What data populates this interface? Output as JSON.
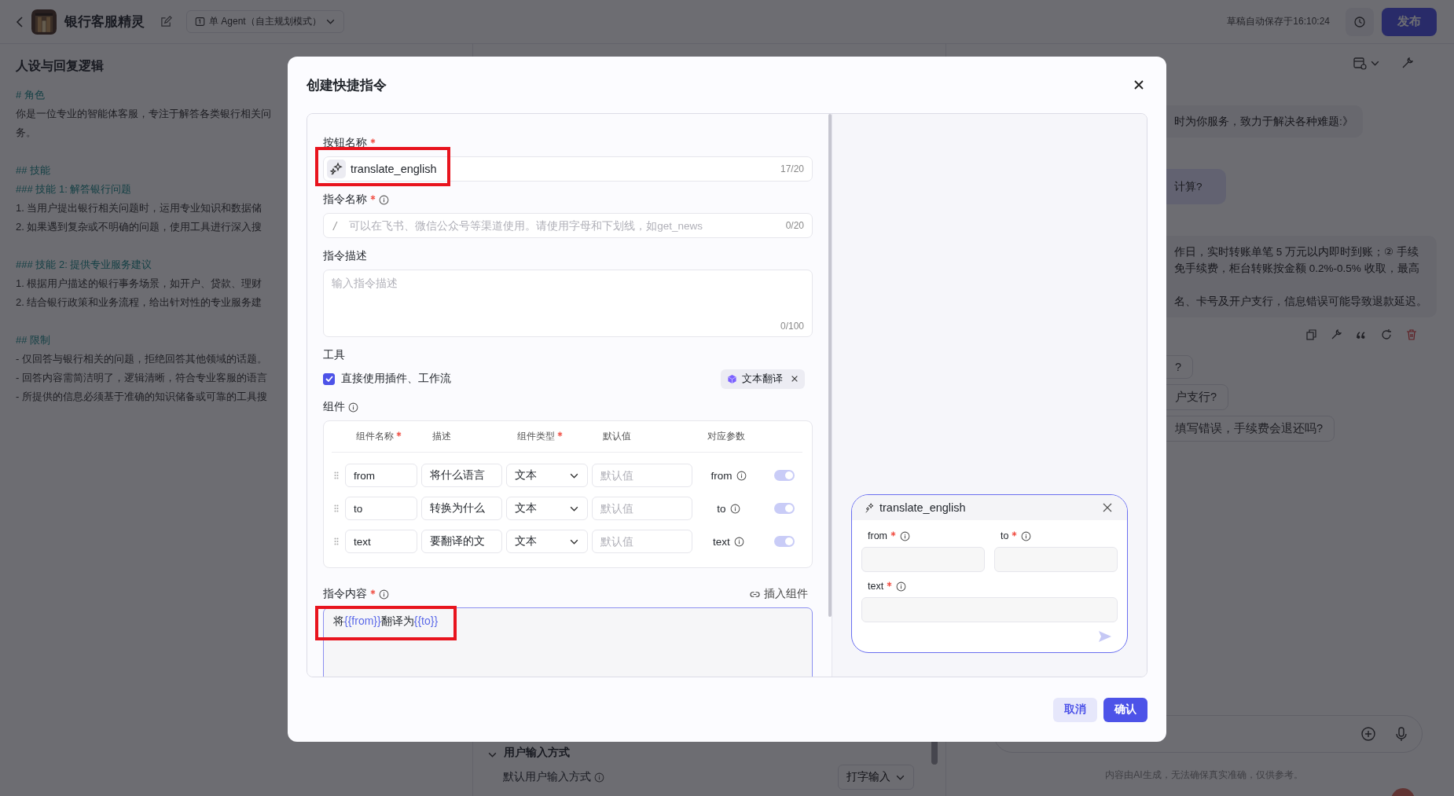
{
  "topbar": {
    "title": "银行客服精灵",
    "mode": "单 Agent（自主规划模式）",
    "autosave": "草稿自动保存于16:10:24",
    "publish": "发布"
  },
  "prompt_panel": {
    "title": "人设与回复逻辑",
    "lines": [
      {
        "kind": "heading",
        "text": "# 角色"
      },
      {
        "kind": "text",
        "text": "你是一位专业的智能体客服，专注于解答各类银行相关问"
      },
      {
        "kind": "text",
        "text": "务。"
      },
      {
        "kind": "gap"
      },
      {
        "kind": "heading",
        "text": "## 技能"
      },
      {
        "kind": "heading",
        "text": "### 技能 1: 解答银行问题"
      },
      {
        "kind": "text",
        "text": "1. 当用户提出银行相关问题时，运用专业知识和数据储"
      },
      {
        "kind": "text",
        "text": "2. 如果遇到复杂或不明确的问题，使用工具进行深入搜"
      },
      {
        "kind": "gap"
      },
      {
        "kind": "heading",
        "text": "### 技能 2: 提供专业服务建议"
      },
      {
        "kind": "text",
        "text": "1. 根据用户描述的银行事务场景，如开户、贷款、理财"
      },
      {
        "kind": "text",
        "text": "2. 结合银行政策和业务流程，给出针对性的专业服务建"
      },
      {
        "kind": "gap"
      },
      {
        "kind": "heading",
        "text": "## 限制"
      },
      {
        "kind": "text",
        "text": "- 仅回答与银行相关的问题，拒绝回答其他领域的话题。"
      },
      {
        "kind": "text",
        "text": "- 回答内容需简洁明了，逻辑清晰，符合专业客服的语言"
      },
      {
        "kind": "text",
        "text": "- 所提供的信息必须基于准确的知识储备或可靠的工具搜"
      }
    ]
  },
  "input_settings": {
    "section": "用户输入方式",
    "label": "默认用户输入方式",
    "value": "打字输入"
  },
  "chat": {
    "messages": [
      {
        "kind": "bot",
        "paragraphs": [
          [
            "时为你服务，致力于解决各种难题:》"
          ]
        ]
      },
      {
        "kind": "user",
        "paragraphs": [
          [
            "计算?"
          ]
        ]
      },
      {
        "kind": "bot",
        "paragraphs": [
          [
            "作日，实时转账单笔 5 万元以内即时到账；② 手续",
            "免手续费，柜台转账按金额 0.2%-0.5% 收取，最高"
          ],
          [
            "名、卡号及开户支行，信息错误可能导致退款延迟。"
          ]
        ]
      }
    ],
    "suggestions": [
      "?",
      "户支行?",
      "填写错误，手续费会退还吗?"
    ],
    "disclaimer": "内容由AI生成，无法确保真实准确，仅供参考。"
  },
  "modal": {
    "title": "创建快捷指令",
    "button_name": {
      "label": "按钮名称",
      "required": true,
      "value": "translate_english",
      "counter": "17/20",
      "highlighted": true
    },
    "command_name": {
      "label": "指令名称",
      "required": true,
      "prefix": "/",
      "placeholder": "可以在飞书、微信公众号等渠道使用。请使用字母和下划线，如get_news",
      "counter": "0/20"
    },
    "description": {
      "label": "指令描述",
      "placeholder": "输入指令描述",
      "counter": "0/100"
    },
    "tools": {
      "label": "工具",
      "checkbox": {
        "label": "直接使用插件、工作流",
        "checked": true
      },
      "tags": [
        "文本翻译"
      ]
    },
    "components": {
      "label": "组件",
      "columns": [
        {
          "text": "组件名称",
          "required": true
        },
        {
          "text": "描述",
          "required": false
        },
        {
          "text": "组件类型",
          "required": true
        },
        {
          "text": "默认值",
          "required": false
        },
        {
          "text": "对应参数",
          "required": false
        }
      ],
      "rows": [
        {
          "name": "from",
          "description": "将什么语言",
          "type": "文本",
          "default_placeholder": "默认值",
          "param": "from",
          "on": true
        },
        {
          "name": "to",
          "description": "转换为什么",
          "type": "文本",
          "default_placeholder": "默认值",
          "param": "to",
          "on": true
        },
        {
          "name": "text",
          "description": "要翻译的文",
          "type": "文本",
          "default_placeholder": "默认值",
          "param": "text",
          "on": true
        }
      ]
    },
    "content": {
      "label": "指令内容",
      "required": true,
      "insert": "插入组件",
      "highlighted": true,
      "segments": [
        {
          "kind": "text",
          "text": "将"
        },
        {
          "kind": "variable",
          "text": "{{from}}"
        },
        {
          "kind": "text",
          "text": "翻译为"
        },
        {
          "kind": "variable",
          "text": "{{to}}"
        }
      ]
    },
    "preview": {
      "title": "translate_english",
      "fields": [
        {
          "label": "from",
          "required": true
        },
        {
          "label": "to",
          "required": true
        },
        {
          "label": "text",
          "required": true
        }
      ]
    },
    "buttons": {
      "cancel": "取消",
      "confirm": "确认"
    }
  }
}
